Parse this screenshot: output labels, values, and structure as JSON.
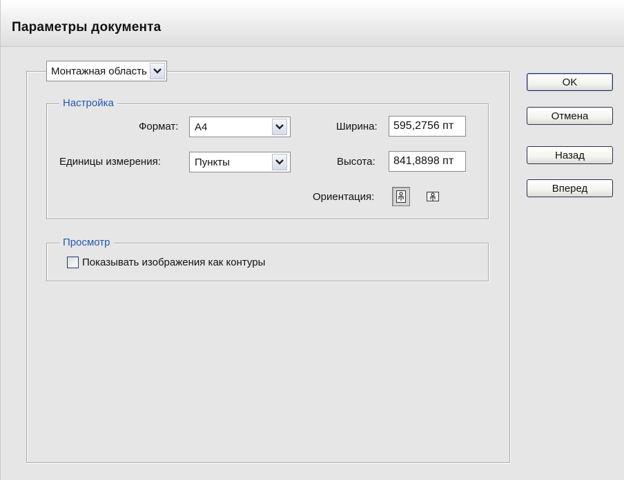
{
  "window": {
    "title": "Параметры документа"
  },
  "artboard": {
    "selector_label": "Монтажная область"
  },
  "settings": {
    "title": "Настройка",
    "format_label": "Формат:",
    "format_value": "A4",
    "units_label": "Единицы измерения:",
    "units_value": "Пункты",
    "width_label": "Ширина:",
    "width_value": "595,2756 пт",
    "height_label": "Высота:",
    "height_value": "841,8898 пт",
    "orientation_label": "Ориентация:",
    "orientation_selected": "portrait"
  },
  "preview": {
    "title": "Просмотр",
    "outline_images_label": "Показывать изображения как контуры",
    "outline_images_checked": false
  },
  "buttons": {
    "ok": "OK",
    "cancel": "Отмена",
    "back": "Назад",
    "forward": "Вперед"
  }
}
